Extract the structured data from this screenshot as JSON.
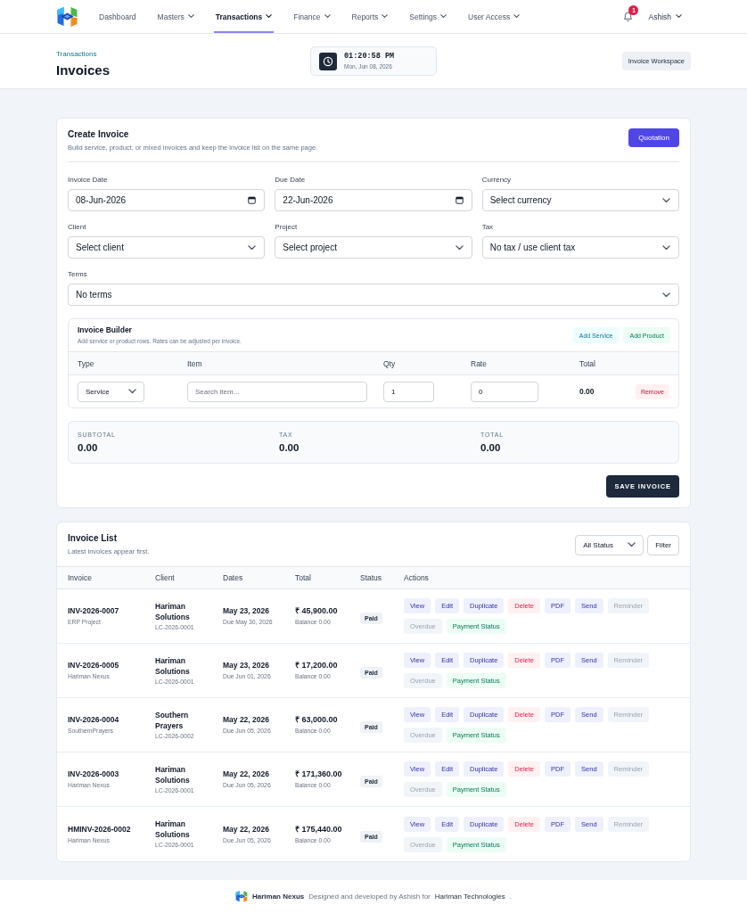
{
  "nav": {
    "items": [
      {
        "label": "Dashboard",
        "selected": false,
        "dropdown": false
      },
      {
        "label": "Masters",
        "selected": false,
        "dropdown": true
      },
      {
        "label": "Transactions",
        "selected": true,
        "dropdown": true
      },
      {
        "label": "Finance",
        "selected": false,
        "dropdown": true
      },
      {
        "label": "Reports",
        "selected": false,
        "dropdown": true
      },
      {
        "label": "Settings",
        "selected": false,
        "dropdown": true
      },
      {
        "label": "User Access",
        "selected": false,
        "dropdown": true
      }
    ],
    "notifications": {
      "count": "1"
    },
    "user": {
      "name": "Ashish"
    }
  },
  "header": {
    "breadcrumb": "Transactions",
    "title": "Invoices",
    "clock": {
      "time": "01:20:58 PM",
      "date": "Mon, Jun 08, 2026"
    },
    "workspace_button": "Invoice Workspace"
  },
  "create_invoice": {
    "title": "Create Invoice",
    "subtitle": "Build service, product, or mixed invoices and keep the invoice list on the same page.",
    "quotation_button": "Quotation",
    "field_rows": [
      [
        {
          "label": "Invoice Date",
          "kind": "date",
          "value": "08-Jun-2026"
        },
        {
          "label": "Due Date",
          "kind": "date",
          "value": "22-Jun-2026"
        },
        {
          "label": "Currency",
          "kind": "select",
          "value": "Select currency"
        }
      ],
      [
        {
          "label": "Client",
          "kind": "select",
          "value": "Select client"
        },
        {
          "label": "Project",
          "kind": "select",
          "value": "Select project"
        },
        {
          "label": "Tax",
          "kind": "select",
          "value": "No tax / use client tax"
        }
      ],
      [
        {
          "label": "Terms",
          "kind": "select",
          "value": "No terms"
        }
      ]
    ],
    "builder": {
      "title": "Invoice Builder",
      "subtitle": "Add service or product rows. Rates can be adjusted per invoice.",
      "buttons": [
        {
          "label": "Add Service",
          "kind": "service"
        },
        {
          "label": "Add Product",
          "kind": "product"
        }
      ],
      "columns": [
        "Type",
        "Item",
        "Qty",
        "Rate",
        "Total"
      ],
      "rows": [
        {
          "type": "Service",
          "item": {
            "placeholder": "Search item..."
          },
          "qty": "1",
          "rate": "0",
          "total": "0.00",
          "remove_button": "Remove"
        }
      ]
    },
    "summary": [
      {
        "label": "SUBTOTAL",
        "value": "0.00"
      },
      {
        "label": "TAX",
        "value": "0.00"
      },
      {
        "label": "TOTAL",
        "value": "0.00"
      }
    ],
    "save_button": "SAVE INVOICE"
  },
  "invoice_list": {
    "title": "Invoice List",
    "subtitle": "Latest invoices appear first.",
    "status_filter": {
      "value": "All Status"
    },
    "filter_button": "Filter",
    "columns": [
      "Invoice",
      "Client",
      "Dates",
      "Total",
      "Status",
      "Actions"
    ],
    "rows": [
      {
        "invoice": "INV-2026-0007",
        "project": "ERP Project",
        "client": "Hariman Solutions",
        "client_code": "LC-2026-0001",
        "date": "May 23, 2026",
        "due": "Due May 30, 2026",
        "total": "₹ 45,900.00",
        "balance": "Balance 0.00",
        "status": "Paid",
        "actions": [
          {
            "label": "View",
            "kind": "action",
            "disabled": false
          },
          {
            "label": "Edit",
            "kind": "action",
            "disabled": false
          },
          {
            "label": "Duplicate",
            "kind": "action",
            "disabled": false
          },
          {
            "label": "Delete",
            "kind": "danger",
            "disabled": false
          },
          {
            "label": "PDF",
            "kind": "action",
            "disabled": false
          },
          {
            "label": "Send",
            "kind": "action",
            "disabled": false
          },
          {
            "label": "Reminder",
            "kind": "action",
            "disabled": true
          },
          {
            "label": "Overdue",
            "kind": "action",
            "disabled": true
          },
          {
            "label": "Payment Status",
            "kind": "success",
            "disabled": false
          }
        ]
      },
      {
        "invoice": "INV-2026-0005",
        "project": "Hariman Nexus",
        "client": "Hariman Solutions",
        "client_code": "LC-2026-0001",
        "date": "May 23, 2026",
        "due": "Due Jun 01, 2026",
        "total": "₹ 17,200.00",
        "balance": "Balance 0.00",
        "status": "Paid",
        "actions": [
          {
            "label": "View",
            "kind": "action",
            "disabled": false
          },
          {
            "label": "Edit",
            "kind": "action",
            "disabled": false
          },
          {
            "label": "Duplicate",
            "kind": "action",
            "disabled": false
          },
          {
            "label": "Delete",
            "kind": "danger",
            "disabled": false
          },
          {
            "label": "PDF",
            "kind": "action",
            "disabled": false
          },
          {
            "label": "Send",
            "kind": "action",
            "disabled": false
          },
          {
            "label": "Reminder",
            "kind": "action",
            "disabled": true
          },
          {
            "label": "Overdue",
            "kind": "action",
            "disabled": true
          },
          {
            "label": "Payment Status",
            "kind": "success",
            "disabled": false
          }
        ]
      },
      {
        "invoice": "INV-2026-0004",
        "project": "SouthernPrayers",
        "client": "Southern Prayers",
        "client_code": "LC-2026-0002",
        "date": "May 22, 2026",
        "due": "Due Jun 05, 2026",
        "total": "₹ 63,000.00",
        "balance": "Balance 0.00",
        "status": "Paid",
        "actions": [
          {
            "label": "View",
            "kind": "action",
            "disabled": false
          },
          {
            "label": "Edit",
            "kind": "action",
            "disabled": false
          },
          {
            "label": "Duplicate",
            "kind": "action",
            "disabled": false
          },
          {
            "label": "Delete",
            "kind": "danger",
            "disabled": false
          },
          {
            "label": "PDF",
            "kind": "action",
            "disabled": false
          },
          {
            "label": "Send",
            "kind": "action",
            "disabled": false
          },
          {
            "label": "Reminder",
            "kind": "action",
            "disabled": true
          },
          {
            "label": "Overdue",
            "kind": "action",
            "disabled": true
          },
          {
            "label": "Payment Status",
            "kind": "success",
            "disabled": false
          }
        ]
      },
      {
        "invoice": "INV-2026-0003",
        "project": "Hariman Nexus",
        "client": "Hariman Solutions",
        "client_code": "LC-2026-0001",
        "date": "May 22, 2026",
        "due": "Due Jun 05, 2026",
        "total": "₹ 171,360.00",
        "balance": "Balance 0.00",
        "status": "Paid",
        "actions": [
          {
            "label": "View",
            "kind": "action",
            "disabled": false
          },
          {
            "label": "Edit",
            "kind": "action",
            "disabled": false
          },
          {
            "label": "Duplicate",
            "kind": "action",
            "disabled": false
          },
          {
            "label": "Delete",
            "kind": "danger",
            "disabled": false
          },
          {
            "label": "PDF",
            "kind": "action",
            "disabled": false
          },
          {
            "label": "Send",
            "kind": "action",
            "disabled": false
          },
          {
            "label": "Reminder",
            "kind": "action",
            "disabled": true
          },
          {
            "label": "Overdue",
            "kind": "action",
            "disabled": true
          },
          {
            "label": "Payment Status",
            "kind": "success",
            "disabled": false
          }
        ]
      },
      {
        "invoice": "HMINV-2026-0002",
        "project": "Hariman Nexus",
        "client": "Hariman Solutions",
        "client_code": "LC-2026-0001",
        "date": "May 22, 2026",
        "due": "Due Jun 05, 2026",
        "total": "₹ 175,440.00",
        "balance": "Balance 0.00",
        "status": "Paid",
        "actions": [
          {
            "label": "View",
            "kind": "action",
            "disabled": false
          },
          {
            "label": "Edit",
            "kind": "action",
            "disabled": false
          },
          {
            "label": "Duplicate",
            "kind": "action",
            "disabled": false
          },
          {
            "label": "Delete",
            "kind": "danger",
            "disabled": false
          },
          {
            "label": "PDF",
            "kind": "action",
            "disabled": false
          },
          {
            "label": "Send",
            "kind": "action",
            "disabled": false
          },
          {
            "label": "Reminder",
            "kind": "action",
            "disabled": true
          },
          {
            "label": "Overdue",
            "kind": "action",
            "disabled": true
          },
          {
            "label": "Payment Status",
            "kind": "success",
            "disabled": false
          }
        ]
      }
    ]
  },
  "footer": {
    "brand": "Hariman Nexus",
    "credit": "Designed and developed by Ashish for",
    "company": "Hariman Technologies",
    "end": "."
  }
}
